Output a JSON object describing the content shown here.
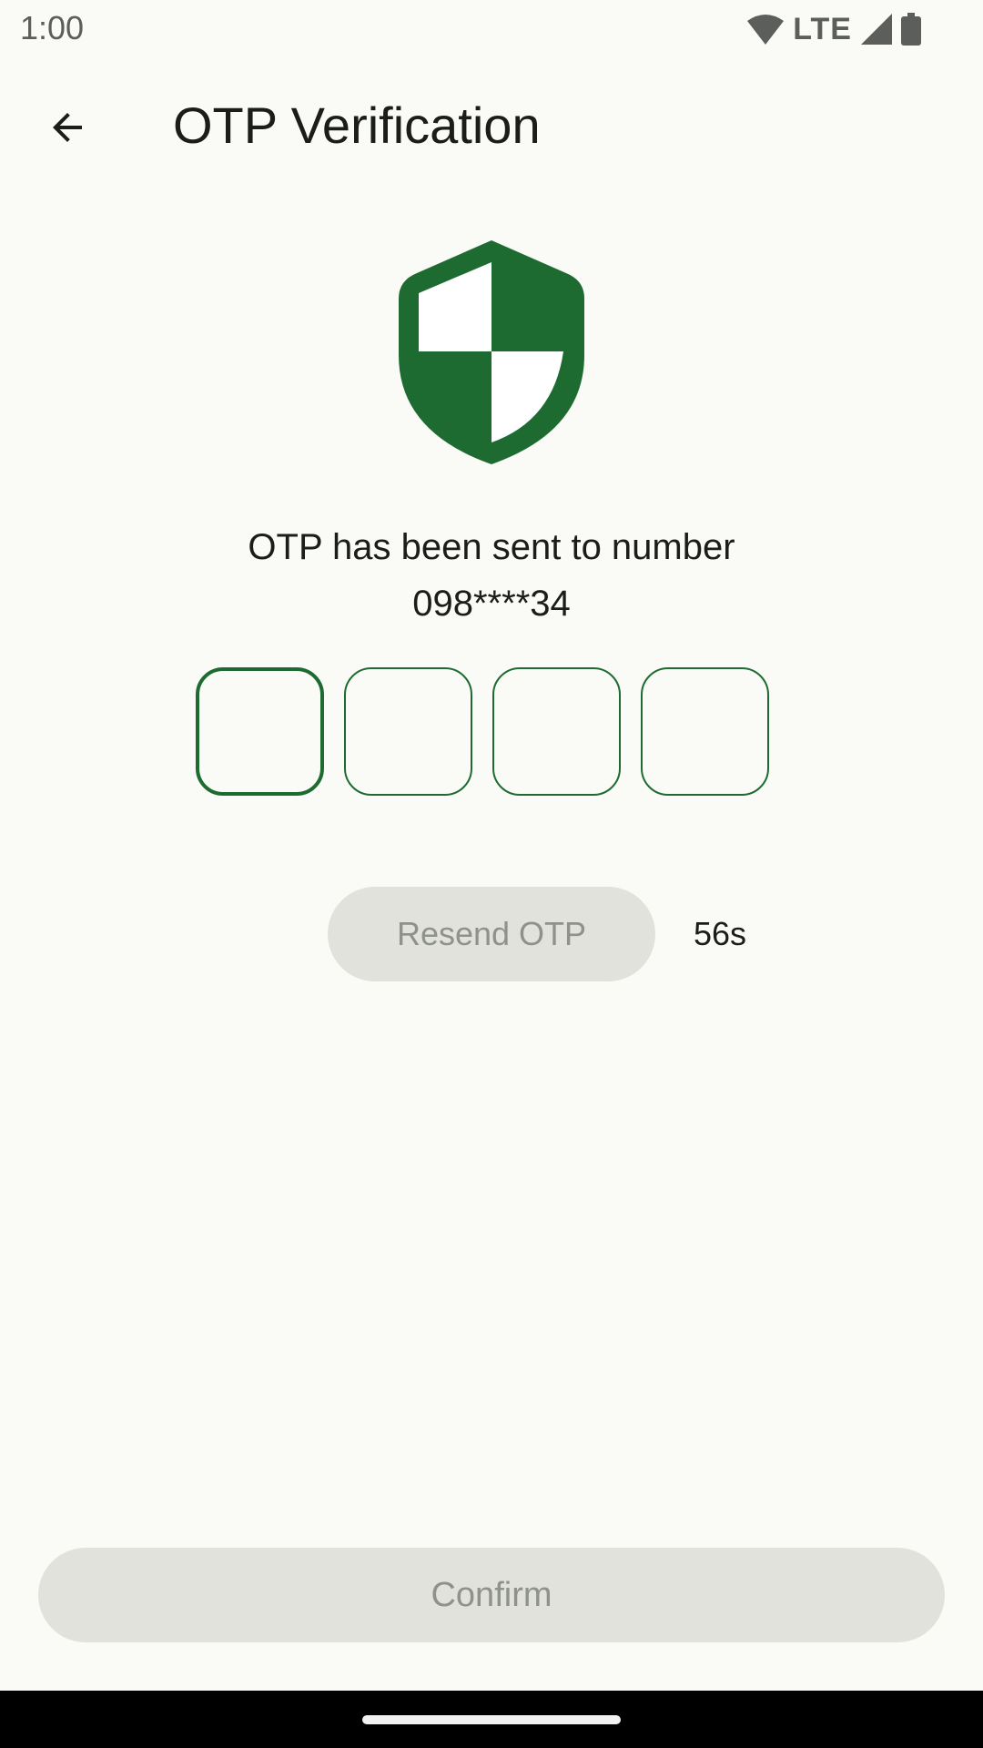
{
  "status_bar": {
    "time": "1:00",
    "network": "LTE"
  },
  "app_bar": {
    "title": "OTP Verification"
  },
  "message": {
    "line1": "OTP has been sent to number",
    "phone": "098****34"
  },
  "otp": {
    "digits": [
      "",
      "",
      "",
      ""
    ]
  },
  "resend": {
    "label": "Resend OTP",
    "countdown": "56s"
  },
  "confirm": {
    "label": "Confirm"
  },
  "colors": {
    "accent": "#1e6b31",
    "background": "#fafbf6",
    "disabled_button": "#e1e2dc",
    "disabled_text": "#8f918c"
  },
  "icons": {
    "back": "arrow-back-icon",
    "shield": "shield-icon",
    "wifi": "wifi-icon",
    "signal": "signal-icon",
    "battery": "battery-icon"
  }
}
